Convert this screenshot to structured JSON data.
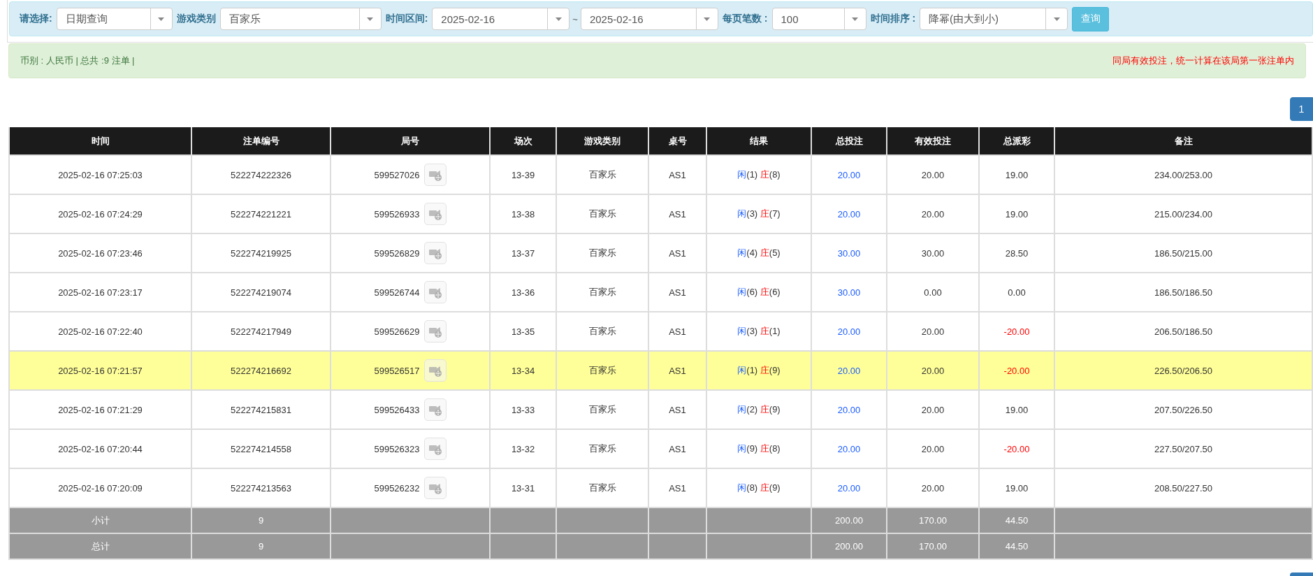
{
  "filters": [
    {
      "label": "请选择:",
      "kind": "select",
      "value": "日期查询"
    },
    {
      "label": "游戏类别",
      "kind": "select",
      "value": "百家乐"
    },
    {
      "label": "时间区间:",
      "kind": "range",
      "value": "2025-02-16",
      "separator": "~",
      "value_to": "2025-02-16"
    },
    {
      "label": "每页笔数 :",
      "kind": "select",
      "value": "100"
    },
    {
      "label": "时间排序 :",
      "kind": "select",
      "value": "降幂(由大到小)"
    }
  ],
  "query_button": "查询",
  "info_bar": {
    "summary": "币别 : 人民币 | 总共 :9 注单 |",
    "notice": "同局有效投注，统一计算在该局第一张注单内"
  },
  "pagination": [
    {
      "label": "1",
      "selected": true
    }
  ],
  "table": {
    "columns": [
      "时间",
      "注单编号",
      "局号",
      "场次",
      "游戏类别",
      "桌号",
      "结果",
      "总投注",
      "有效投注",
      "总派彩",
      "备注"
    ],
    "rows": [
      {
        "time": "2025-02-16 07:25:03",
        "ticket": "522274222326",
        "round": "599527026",
        "shoe": "13-39",
        "game": "百家乐",
        "table": "AS1",
        "player": "闲",
        "player_count": "(1)",
        "banker": "庄",
        "banker_count": "(8)",
        "bet": "20.00",
        "valid": "20.00",
        "payout": "19.00",
        "loss": false,
        "note": "234.00/253.00",
        "selected": false
      },
      {
        "time": "2025-02-16 07:24:29",
        "ticket": "522274221221",
        "round": "599526933",
        "shoe": "13-38",
        "game": "百家乐",
        "table": "AS1",
        "player": "闲",
        "player_count": "(3)",
        "banker": "庄",
        "banker_count": "(7)",
        "bet": "20.00",
        "valid": "20.00",
        "payout": "19.00",
        "loss": false,
        "note": "215.00/234.00",
        "selected": false
      },
      {
        "time": "2025-02-16 07:23:46",
        "ticket": "522274219925",
        "round": "599526829",
        "shoe": "13-37",
        "game": "百家乐",
        "table": "AS1",
        "player": "闲",
        "player_count": "(4)",
        "banker": "庄",
        "banker_count": "(5)",
        "bet": "30.00",
        "valid": "30.00",
        "payout": "28.50",
        "loss": false,
        "note": "186.50/215.00",
        "selected": false
      },
      {
        "time": "2025-02-16 07:23:17",
        "ticket": "522274219074",
        "round": "599526744",
        "shoe": "13-36",
        "game": "百家乐",
        "table": "AS1",
        "player": "闲",
        "player_count": "(6)",
        "banker": "庄",
        "banker_count": "(6)",
        "bet": "30.00",
        "valid": "0.00",
        "payout": "0.00",
        "loss": false,
        "note": "186.50/186.50",
        "selected": false
      },
      {
        "time": "2025-02-16 07:22:40",
        "ticket": "522274217949",
        "round": "599526629",
        "shoe": "13-35",
        "game": "百家乐",
        "table": "AS1",
        "player": "闲",
        "player_count": "(3)",
        "banker": "庄",
        "banker_count": "(1)",
        "bet": "20.00",
        "valid": "20.00",
        "payout": "-20.00",
        "loss": true,
        "note": "206.50/186.50",
        "selected": false
      },
      {
        "time": "2025-02-16 07:21:57",
        "ticket": "522274216692",
        "round": "599526517",
        "shoe": "13-34",
        "game": "百家乐",
        "table": "AS1",
        "player": "闲",
        "player_count": "(1)",
        "banker": "庄",
        "banker_count": "(9)",
        "bet": "20.00",
        "valid": "20.00",
        "payout": "-20.00",
        "loss": true,
        "note": "226.50/206.50",
        "selected": true
      },
      {
        "time": "2025-02-16 07:21:29",
        "ticket": "522274215831",
        "round": "599526433",
        "shoe": "13-33",
        "game": "百家乐",
        "table": "AS1",
        "player": "闲",
        "player_count": "(2)",
        "banker": "庄",
        "banker_count": "(9)",
        "bet": "20.00",
        "valid": "20.00",
        "payout": "19.00",
        "loss": false,
        "note": "207.50/226.50",
        "selected": false
      },
      {
        "time": "2025-02-16 07:20:44",
        "ticket": "522274214558",
        "round": "599526323",
        "shoe": "13-32",
        "game": "百家乐",
        "table": "AS1",
        "player": "闲",
        "player_count": "(9)",
        "banker": "庄",
        "banker_count": "(8)",
        "bet": "20.00",
        "valid": "20.00",
        "payout": "-20.00",
        "loss": true,
        "note": "227.50/207.50",
        "selected": false
      },
      {
        "time": "2025-02-16 07:20:09",
        "ticket": "522274213563",
        "round": "599526232",
        "shoe": "13-31",
        "game": "百家乐",
        "table": "AS1",
        "player": "闲",
        "player_count": "(8)",
        "banker": "庄",
        "banker_count": "(9)",
        "bet": "20.00",
        "valid": "20.00",
        "payout": "19.00",
        "loss": false,
        "note": "208.50/227.50",
        "selected": false
      }
    ],
    "totals": [
      {
        "label": "小计",
        "count": "9",
        "bet": "200.00",
        "valid": "170.00",
        "payout": "44.50"
      },
      {
        "label": "总计",
        "count": "9",
        "bet": "200.00",
        "valid": "170.00",
        "payout": "44.50"
      }
    ]
  }
}
